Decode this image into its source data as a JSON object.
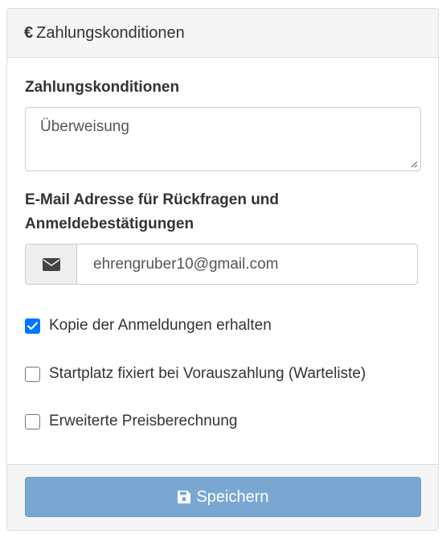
{
  "panel": {
    "title": "Zahlungskonditionen",
    "title_icon": "euro-icon"
  },
  "payment_terms": {
    "label": "Zahlungskonditionen",
    "value": "Überweisung"
  },
  "email": {
    "label_line1": "E-Mail Adresse für Rückfragen und",
    "label_line2": "Anmeldebestätigungen",
    "icon": "envelope-icon",
    "value": "ehrengruber10@gmail.com"
  },
  "options": [
    {
      "label": "Kopie der Anmeldungen erhalten",
      "checked": true
    },
    {
      "label": "Startplatz fixiert bei Vorauszahlung (Warteliste)",
      "checked": false
    },
    {
      "label": "Erweiterte Preisberechnung",
      "checked": false
    }
  ],
  "footer": {
    "save_label": "Speichern",
    "save_icon": "floppy-disk-icon"
  },
  "colors": {
    "checkbox_accent": "#0075ff",
    "button_bg": "#7aa7d1",
    "panel_heading_bg": "#f5f5f5"
  }
}
